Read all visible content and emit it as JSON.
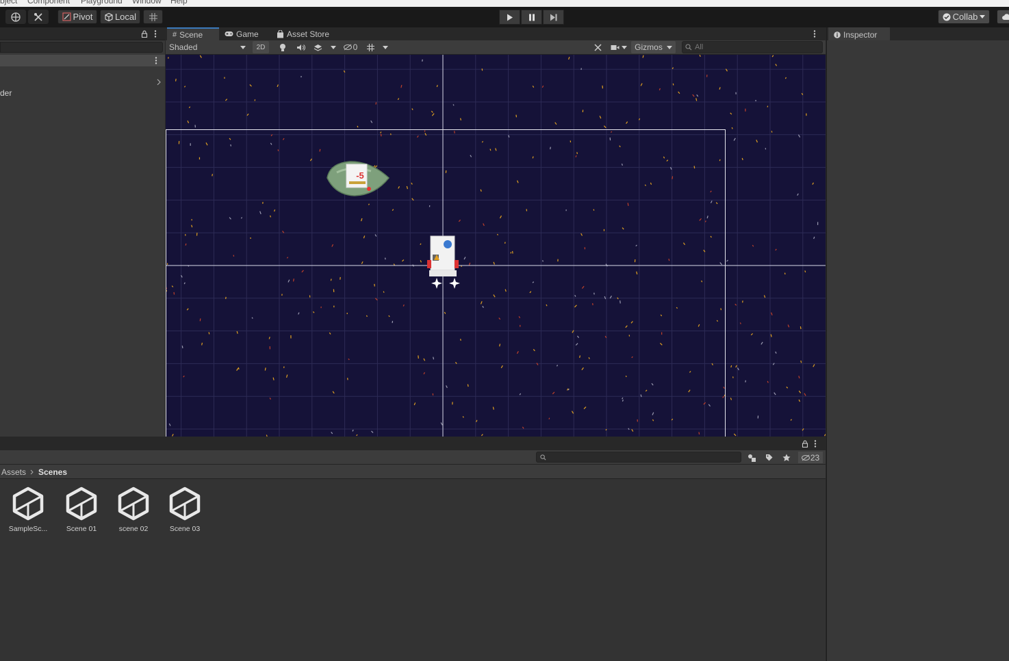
{
  "menu": {
    "items": [
      "bject",
      "Component",
      "Playground",
      "Window",
      "Help"
    ]
  },
  "toolbar": {
    "pivot_label": "Pivot",
    "local_label": "Local",
    "collab_label": "Collab"
  },
  "hierarchy": {
    "partial_text": "der"
  },
  "scene_view": {
    "tabs": [
      {
        "label": "Scene",
        "icon": "grid-icon",
        "active": true
      },
      {
        "label": "Game",
        "icon": "gamepad-icon",
        "active": false
      },
      {
        "label": "Asset Store",
        "icon": "bag-icon",
        "active": false
      }
    ],
    "shading_mode": "Shaded",
    "mode_2d": "2D",
    "hidden_count": "0",
    "gizmos_label": "Gizmos",
    "search_placeholder": "All",
    "enemy_badge": "-5"
  },
  "project": {
    "hidden_count": "23",
    "breadcrumb": [
      "Assets",
      "Scenes"
    ],
    "assets": [
      {
        "name": "SampleSc...",
        "icon": "unity-scene-icon"
      },
      {
        "name": "Scene 01",
        "icon": "unity-scene-icon"
      },
      {
        "name": "scene 02",
        "icon": "unity-scene-icon"
      },
      {
        "name": "Scene 03",
        "icon": "unity-scene-icon"
      }
    ]
  },
  "inspector": {
    "tab_label": "Inspector"
  },
  "colors": {
    "scene_bg": "#151238",
    "accent_tab": "#3a79bb",
    "star_yellow": "#e0a020",
    "star_red": "#c0402a"
  }
}
